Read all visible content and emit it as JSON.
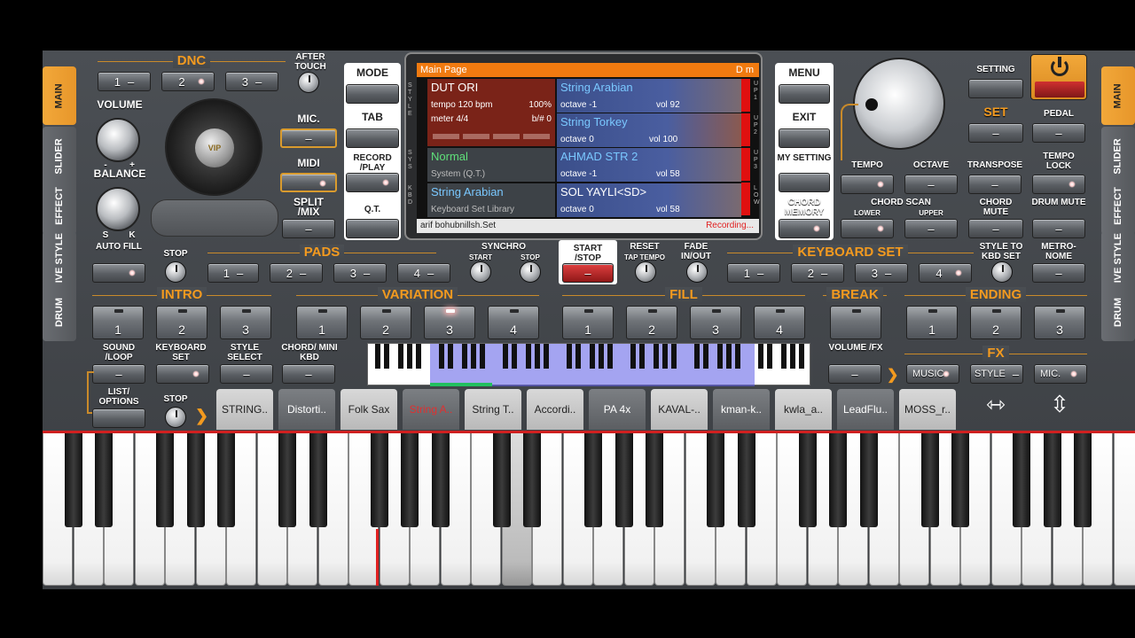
{
  "dnc": {
    "title": "DNC",
    "b1": "1",
    "b2": "2",
    "b3": "3",
    "after_touch": "AFTER TOUCH"
  },
  "volume": "VOLUME",
  "balance": "BALANCE",
  "bal_s": "S",
  "bal_k": "K",
  "vol_minus": "-",
  "vol_plus": "+",
  "jog_label": "VIP",
  "mic_label": "MIC.",
  "midi_label": "MIDI",
  "split_label": "SPLIT /MIX",
  "mode_label": "MODE",
  "tab_label": "TAB",
  "record_label": "RECORD /PLAY",
  "qt_label": "Q.T.",
  "screen": {
    "header": "Main Page",
    "header_right": "D m",
    "style_name": "DUT ORI",
    "tempo": "tempo 120 bpm",
    "meter": "meter 4/4",
    "vol_pct": "100%",
    "bsharp": "b/# 0",
    "sys_name": "Normal",
    "sys_sub": "System (Q.T.)",
    "kbd_name": "String Arabian",
    "kbd_sub": "Keyboard Set Library",
    "up1_name": "String Arabian",
    "up1_oct": "octave -1",
    "up1_vol": "vol 92",
    "up2_name": "String Torkey",
    "up2_oct": "octave  0",
    "up2_vol": "vol 100",
    "up3_name": "AHMAD STR 2",
    "up3_oct": "octave -1",
    "up3_vol": "vol 58",
    "low_name": "SOL YAYLI<SD>",
    "low_oct": "octave  0",
    "low_vol": "vol 58",
    "footer": "arif bohubnillsh.Set",
    "status": "Recording...",
    "side_style": "STYLE",
    "side_sys": "SYS",
    "side_kbd": "KBD",
    "tag_up1": "UP1",
    "tag_up2": "UP2",
    "tag_up3": "UP3",
    "tag_low": "LOW"
  },
  "menu_label": "MENU",
  "exit_label": "EXIT",
  "my_setting": "MY SETTING",
  "chord_memory": "CHORD MEMORY",
  "setting_label": "SETTING",
  "set_label": "SET",
  "pedal_label": "PEDAL",
  "tempo_label": "TEMPO",
  "octave_label": "OCTAVE",
  "transpose_label": "TRANSPOSE",
  "tempo_lock": "TEMPO LOCK",
  "chord_scan": "CHORD SCAN",
  "lower_label": "LOWER",
  "upper_label": "UPPER",
  "chord_mute": "CHORD MUTE",
  "drum_mute": "DRUM MUTE",
  "side_tabs": [
    "MAIN",
    "SLIDER",
    "EFFECT",
    "LIVE STYLE",
    "DRUM"
  ],
  "auto_fill": "AUTO FILL",
  "stop_label": "STOP",
  "pads_title": "PADS",
  "pads": [
    "1",
    "2",
    "3",
    "4"
  ],
  "synchro": "SYNCHRO",
  "sync_start": "START",
  "sync_stop": "STOP",
  "start_stop": "START /STOP",
  "reset_tap": "RESET",
  "tap_tempo": "TAP TEMPO",
  "fade": "FADE IN/OUT",
  "kbset_title": "KEYBOARD SET",
  "kbset": [
    "1",
    "2",
    "3",
    "4"
  ],
  "style_to_kbd": "STYLE TO KBD SET",
  "metronome": "METRO- NOME",
  "intro_title": "INTRO",
  "intro": [
    "1",
    "2",
    "3"
  ],
  "variation_title": "VARIATION",
  "variation": [
    "1",
    "2",
    "3",
    "4"
  ],
  "fill_title": "FILL",
  "fill": [
    "1",
    "2",
    "3",
    "4"
  ],
  "break_title": "BREAK",
  "ending_title": "ENDING",
  "ending": [
    "1",
    "2",
    "3"
  ],
  "sound_loop": "SOUND /LOOP",
  "keyboard_set": "KEYBOARD SET",
  "style_select": "STYLE SELECT",
  "chord_mini": "CHORD/ MINI KBD",
  "volume_fx": "VOLUME /FX",
  "fx_title": "FX",
  "fx_music": "MUSIC",
  "fx_style": "STYLE",
  "fx_mic": "MIC.",
  "list_options": "LIST/ OPTIONS",
  "stop2": "STOP",
  "voices": [
    "STRING..",
    "Distorti..",
    "Folk Sax",
    "String A..",
    "String T..",
    "Accordi..",
    "PA 4x",
    "KAVAL-..",
    "kman-k..",
    "kwla_a..",
    "LeadFlu..",
    "MOSS_r.."
  ],
  "colors": {
    "accent": "#f39a1f",
    "active_voice": "#e03030",
    "screen_header": "#f07a10"
  }
}
